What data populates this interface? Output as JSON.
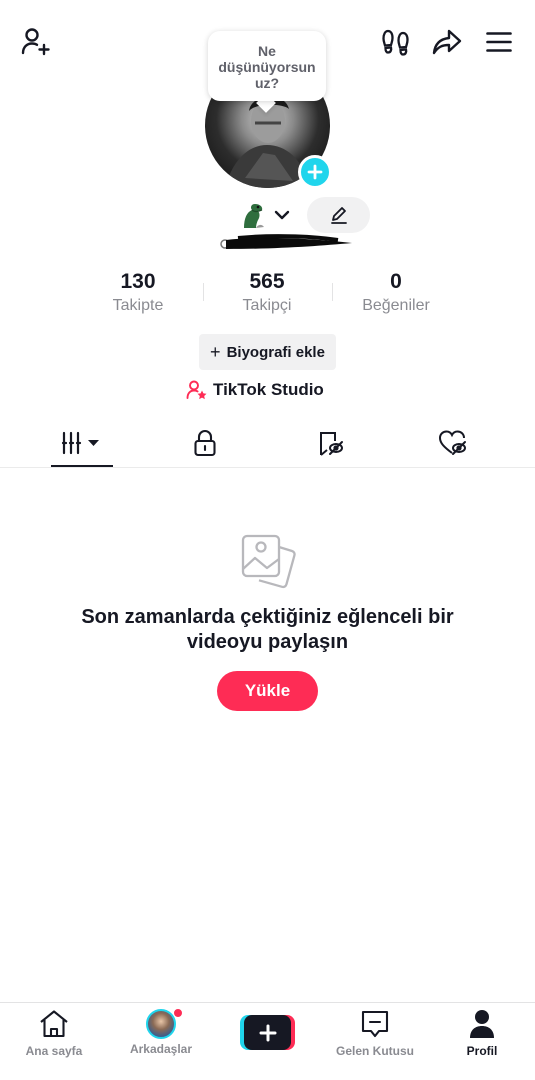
{
  "header": {
    "add_friend_icon": "person-plus-icon",
    "footprint_icon": "footprint-icon",
    "share_icon": "share-arrow-icon",
    "menu_icon": "hamburger-menu-icon"
  },
  "profile": {
    "note_bubble_text": "Ne düşünüyorsun uz?",
    "avatar_add_icon": "plus-icon",
    "edit_icon": "pencil-icon"
  },
  "stats": {
    "following_count": "130",
    "following_label": "Takipte",
    "followers_count": "565",
    "followers_label": "Takipçi",
    "likes_count": "0",
    "likes_label": "Beğeniler"
  },
  "actions": {
    "bio_plus": "+",
    "bio_label": "Biyografi ekle",
    "studio_label": "TikTok Studio"
  },
  "tabs": [
    {
      "name": "videos",
      "icon": "grid-bars-icon",
      "active": true
    },
    {
      "name": "private",
      "icon": "lock-icon",
      "active": false
    },
    {
      "name": "reposts",
      "icon": "repost-hidden-icon",
      "active": false
    },
    {
      "name": "liked",
      "icon": "heart-hidden-icon",
      "active": false
    }
  ],
  "empty_state": {
    "icon": "photos-icon",
    "title": "Son zamanlarda çektiğiniz eğlenceli bir videoyu paylaşın",
    "button_label": "Yükle"
  },
  "bottom_nav": {
    "home_label": "Ana sayfa",
    "friends_label": "Arkadaşlar",
    "inbox_label": "Gelen Kutusu",
    "profile_label": "Profil"
  },
  "colors": {
    "accent": "#fe2c55",
    "cyan": "#20d5ec",
    "text": "#161823",
    "muted": "#8a8b91"
  }
}
